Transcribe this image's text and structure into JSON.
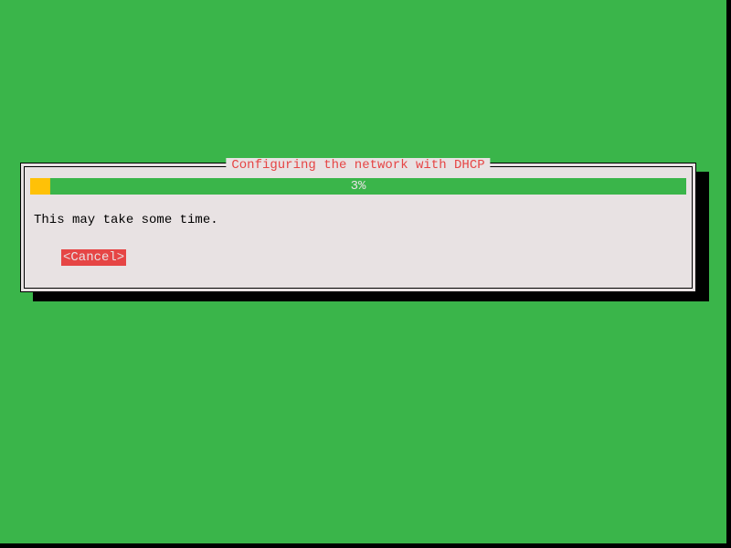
{
  "dialog": {
    "title": "Configuring the network with DHCP",
    "progress_percent_label": "3%",
    "subtext": "This may take some time.",
    "cancel_label": "<Cancel>"
  },
  "colors": {
    "background": "#3ab54a",
    "dialog_bg": "#e8e2e3",
    "accent_red": "#e64545",
    "progress_done": "#ffc107",
    "progress_remaining": "#3ab54a"
  }
}
